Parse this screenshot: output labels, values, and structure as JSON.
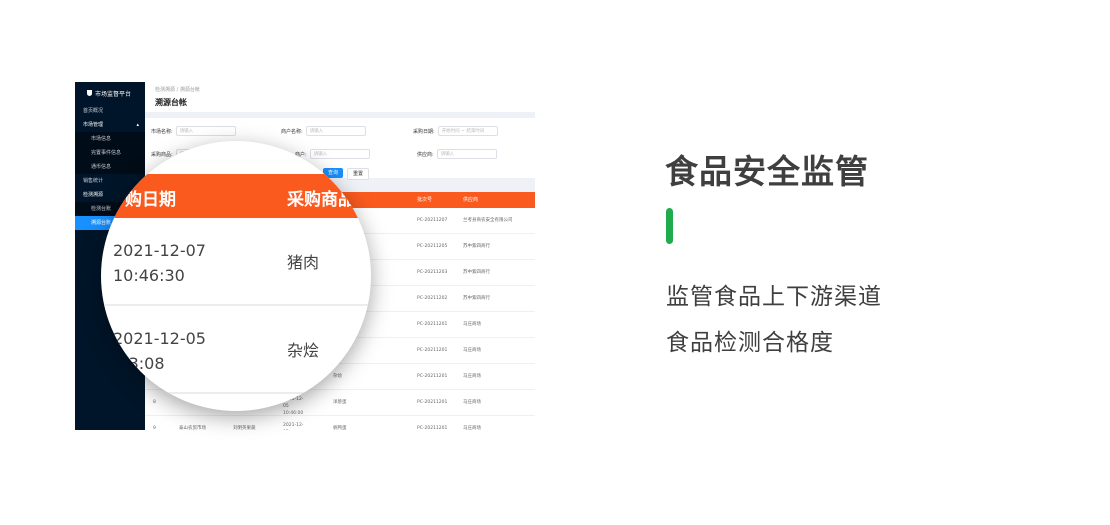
{
  "app": {
    "brand": "市场监督平台",
    "menu": [
      {
        "label": "首页概况",
        "kind": "item"
      },
      {
        "label": "市场管理",
        "kind": "group"
      },
      {
        "label": "市场信息",
        "kind": "sub"
      },
      {
        "label": "完置事件信息",
        "kind": "sub"
      },
      {
        "label": "通币信息",
        "kind": "sub"
      },
      {
        "label": "销售统计",
        "kind": "item"
      },
      {
        "label": "检测溯源",
        "kind": "group"
      },
      {
        "label": "检测台账",
        "kind": "sub"
      },
      {
        "label": "溯源台账",
        "kind": "sub-active"
      }
    ],
    "breadcrumb": "检测溯源 / 溯源台帐",
    "page_title": "溯源台帐",
    "filters": {
      "market_label": "市场名称:",
      "market_placeholder": "请输入",
      "tenant_label": "商户名称:",
      "tenant_placeholder": "请输入",
      "date_label": "采购日期:",
      "date_placeholder": "开始时间  ~  结束时间",
      "goods_label": "采购商品:",
      "goods_placeholder": "请输入",
      "goods2_label": "商户:",
      "goods2_placeholder": "请输入",
      "supplier_label": "供应商:",
      "supplier_placeholder": "请输入",
      "query_label": "查询",
      "reset_label": "重置"
    },
    "table": {
      "headers": {
        "batch": "批次号",
        "supplier": "供应商"
      },
      "rows": [
        {
          "batch": "PC-20211207",
          "supplier": "兰考县商农安全有限公司"
        },
        {
          "batch": "PC-20211205",
          "supplier": "苏中紫四商行"
        },
        {
          "batch": "PC-20211203",
          "supplier": "苏中紫四商行"
        },
        {
          "batch": "PC-20211202",
          "supplier": "苏中紫四商行"
        },
        {
          "batch": "PC-20211201",
          "supplier": "马庄商场"
        },
        {
          "batch": "PC-20211201",
          "supplier": "马庄商场"
        },
        {
          "cols": [
            "",
            "",
            "",
            "杂烩"
          ],
          "batch": "PC-20211201",
          "supplier": "马庄商场"
        },
        {
          "cols": [
            "8",
            "",
            "2021-12-05 10:46:00",
            "洋葱蛋"
          ],
          "batch": "PC-20211201",
          "supplier": "马庄商场"
        },
        {
          "cols": [
            "9",
            "泰山农贸市场",
            "刘明英果蔬",
            "2021-12-05 10:46:00"
          ],
          "extra": "帆鸭蛋",
          "batch": "PC-20211201",
          "supplier": "马庄商场"
        }
      ]
    }
  },
  "magnifier": {
    "headers": {
      "date": "购日期",
      "goods": "采购商品"
    },
    "rows": [
      {
        "date": "2021-12-07\n10:46:30",
        "goods": "猪肉"
      },
      {
        "date": "2021-12-05\n:53:08",
        "goods": "杂烩"
      }
    ]
  },
  "marketing": {
    "title": "食品安全监管",
    "line1": "监管食品上下游渠道",
    "line2": "食品检测合格度",
    "accent_color": "#1fac4d",
    "header_color": "#fa5a1e",
    "active_color": "#1890ff"
  }
}
